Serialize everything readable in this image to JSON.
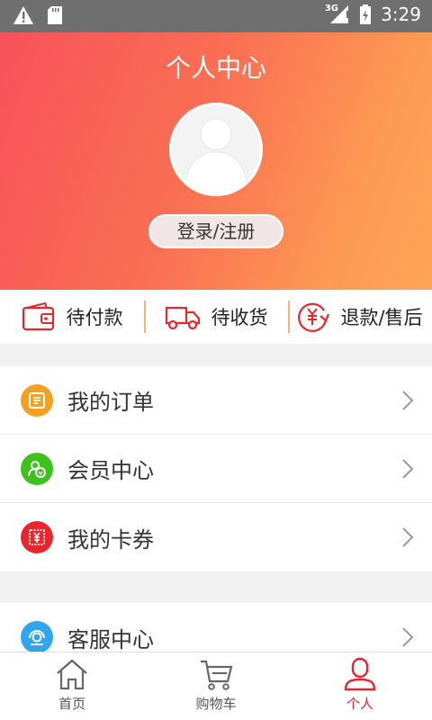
{
  "status_bar": {
    "time": "3:29",
    "network": "3G",
    "icons": [
      "warning-icon",
      "sd-card-icon",
      "signal-icon",
      "battery-icon"
    ]
  },
  "header": {
    "title": "个人中心",
    "login_label": "登录/注册"
  },
  "shortcuts": [
    {
      "label": "待付款",
      "icon": "wallet-icon"
    },
    {
      "label": "待收货",
      "icon": "truck-icon"
    },
    {
      "label": "退款/售后",
      "icon": "refund-icon"
    }
  ],
  "menu": {
    "group1": [
      {
        "label": "我的订单",
        "icon": "order-icon",
        "color": "#f5a020"
      },
      {
        "label": "会员中心",
        "icon": "member-icon",
        "color": "#3cc21b"
      },
      {
        "label": "我的卡券",
        "icon": "coupon-icon",
        "color": "#e8262c"
      }
    ],
    "group2": [
      {
        "label": "客服中心",
        "icon": "service-icon",
        "color": "#2fa6ee"
      }
    ]
  },
  "tabbar": [
    {
      "label": "首页",
      "icon": "home-icon"
    },
    {
      "label": "购物车",
      "icon": "cart-icon"
    },
    {
      "label": "个人",
      "icon": "person-icon",
      "active": true
    }
  ],
  "colors": {
    "accent": "#e8262c",
    "header_gradient_start": "#f7525a",
    "header_gradient_end": "#fea556"
  }
}
